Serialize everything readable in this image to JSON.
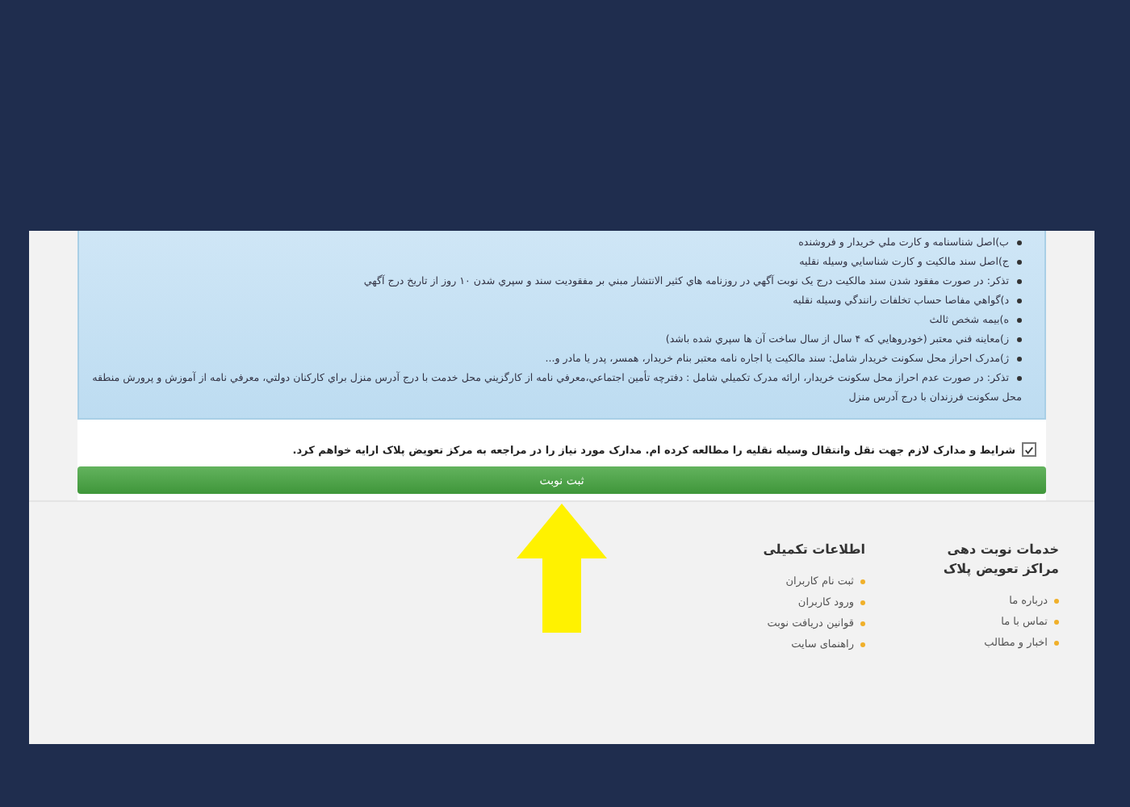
{
  "info_list": [
    "ب)اصل شناسنامه و کارت ملي خريدار و فروشنده",
    "ج)اصل سند مالکيت و کارت شناسايي وسيله نقليه",
    "تذکر: در صورت مفقود شدن سند مالکيت درج يک نوبت آگهي در روزنامه هاي کثير الانتشار مبني بر مفقوديت سند و سپري شدن ۱۰ روز از تاريخ درج آگهي",
    "د)گواهي مفاصا حساب تخلفات رانندگي وسيله نقليه",
    "ه)بيمه شخص ثالث",
    "ز)معاينه فني معتبر (خودروهايي که ۴ سال از سال ساخت آن ها سپري شده باشد)",
    "ژ)مدرک احراز محل سکونت خريدار شامل: سند مالکيت يا اجاره نامه معتبر بنام خريدار، همسر، پدر يا مادر و...",
    "تذکر: در صورت عدم احراز محل سکونت خريدار، ارائه مدرک تکميلي شامل : دفترچه تأمين اجتماعي،معرفي نامه از کارگزيني محل خدمت با درج آدرس منزل براي کارکنان دولتي، معرفي نامه از آموزش و پرورش منطقه محل سکونت فرزندان با درج آدرس منزل"
  ],
  "agreement": {
    "label": "شرایط و مدارک لازم جهت نقل وانتقال وسیله نقلیه را مطالعه کرده ام. مدارک مورد نیاز را در مراجعه به مرکز تعویض پلاک ارایه خواهم کرد.",
    "checked": true
  },
  "submit_button": "ثبت نوبت",
  "footer": [
    {
      "title": "خدمات نوبت دهی مراکز تعویض پلاک",
      "links": [
        "درباره ما",
        "تماس با ما",
        "اخبار و مطالب"
      ]
    },
    {
      "title": "اطلاعات تکمیلی",
      "links": [
        "ثبت نام کاربران",
        "ورود کاربران",
        "قوانین دریافت نوبت",
        "راهنمای سایت"
      ]
    }
  ]
}
